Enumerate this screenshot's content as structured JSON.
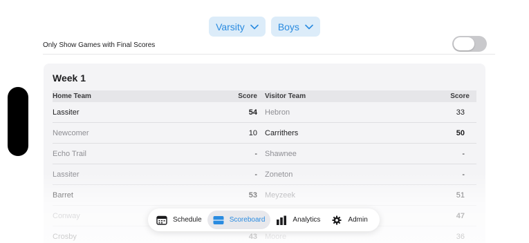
{
  "filters": {
    "level": "Varsity",
    "gender": "Boys"
  },
  "toggle": {
    "label": "Only Show Games with Final Scores",
    "on": false
  },
  "week": {
    "title": "Week 1"
  },
  "table": {
    "headers": {
      "home": "Home Team",
      "home_score": "Score",
      "visitor": "Visitor Team",
      "visitor_score": "Score"
    },
    "rows": [
      {
        "home": "Lassiter",
        "home_score": "54",
        "visitor": "Hebron",
        "visitor_score": "33",
        "winner": "home"
      },
      {
        "home": "Newcomer",
        "home_score": "10",
        "visitor": "Carrithers",
        "visitor_score": "50",
        "winner": "visitor"
      },
      {
        "home": "Echo Trail",
        "home_score": "-",
        "visitor": "Shawnee",
        "visitor_score": "-",
        "winner": "none"
      },
      {
        "home": "Lassiter",
        "home_score": "-",
        "visitor": "Zoneton",
        "visitor_score": "-",
        "winner": "none"
      },
      {
        "home": "Barret",
        "home_score": "53",
        "visitor": "Meyzeek",
        "visitor_score": "51",
        "winner": "home"
      },
      {
        "home": "Conway",
        "home_score": "",
        "visitor": "",
        "visitor_score": "47",
        "winner": "visitor"
      },
      {
        "home": "Crosby",
        "home_score": "43",
        "visitor": "Moore",
        "visitor_score": "36",
        "winner": "home"
      }
    ]
  },
  "tabs": [
    {
      "label": "Schedule",
      "icon": "calendar-icon",
      "active": false
    },
    {
      "label": "Scoreboard",
      "icon": "scoreboard-icon",
      "active": true
    },
    {
      "label": "Analytics",
      "icon": "bar-chart-icon",
      "active": false
    },
    {
      "label": "Admin",
      "icon": "gear-icon",
      "active": false
    }
  ],
  "colors": {
    "accent": "#2a8be0",
    "pill_bg": "#dcecf9",
    "card_bg": "#f4f4f6"
  }
}
